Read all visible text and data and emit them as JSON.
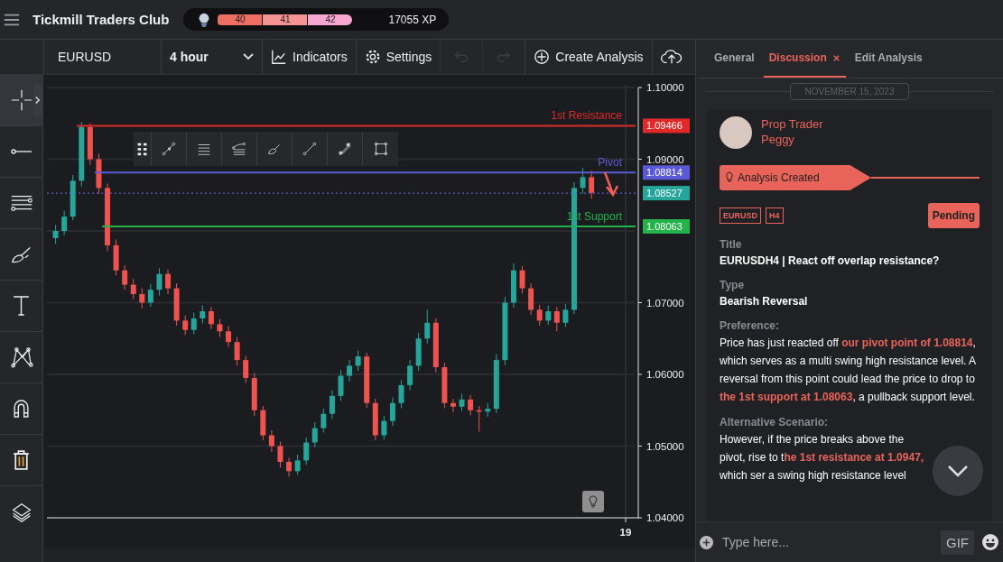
{
  "app": {
    "title": "Tickmill Traders Club",
    "levels": [
      {
        "label": "40",
        "color": "#ee6e62"
      },
      {
        "label": "41",
        "color": "#f59393"
      },
      {
        "label": "42",
        "color": "#f6a6cf"
      }
    ],
    "xp": "17055 XP"
  },
  "toolbar": {
    "symbol": "EURUSD",
    "timeframe": "4 hour",
    "items": [
      {
        "kind": "chart",
        "label": "Indicators",
        "disabled": false
      },
      {
        "kind": "gear",
        "label": "Settings",
        "disabled": false
      },
      {
        "kind": "undo",
        "disabled": true
      },
      {
        "kind": "redo",
        "disabled": true
      },
      {
        "kind": "plus",
        "label": "Create Analysis",
        "disabled": false
      },
      {
        "kind": "upload",
        "disabled": false
      }
    ]
  },
  "tools": [
    {
      "kind": "crosshair",
      "selected": true
    },
    {
      "kind": "hline",
      "selected": false
    },
    {
      "kind": "channel",
      "selected": false
    },
    {
      "kind": "brush",
      "selected": false
    },
    {
      "kind": "text",
      "selected": false
    },
    {
      "kind": "pattern",
      "selected": false
    },
    {
      "kind": "magnet",
      "selected": false
    },
    {
      "kind": "trash",
      "selected": false
    },
    {
      "kind": "layers",
      "selected": false
    }
  ],
  "drawing_tools": [
    {
      "kind": "grip"
    },
    {
      "kind": "ray"
    },
    {
      "kind": "parallel"
    },
    {
      "kind": "fib"
    },
    {
      "kind": "brush"
    },
    {
      "kind": "line"
    },
    {
      "kind": "segment"
    },
    {
      "kind": "rect"
    }
  ],
  "chart": {
    "chart_data": {
      "type": "candlestick",
      "grid": true,
      "ohlc": [
        [
          1.079,
          1.0808,
          1.0782,
          1.08
        ],
        [
          1.08,
          1.0828,
          1.0794,
          1.082
        ],
        [
          1.082,
          1.0878,
          1.0815,
          1.087
        ],
        [
          1.087,
          1.0952,
          1.0862,
          1.0945
        ],
        [
          1.0945,
          1.095,
          1.0892,
          1.09
        ],
        [
          1.09,
          1.0908,
          1.0852,
          1.086
        ],
        [
          1.086,
          1.0866,
          1.0772,
          1.078
        ],
        [
          1.078,
          1.0788,
          1.0738,
          1.0745
        ],
        [
          1.0745,
          1.0752,
          1.0718,
          1.0725
        ],
        [
          1.0725,
          1.0733,
          1.0705,
          1.0712
        ],
        [
          1.0712,
          1.072,
          1.0692,
          1.07
        ],
        [
          1.07,
          1.0726,
          1.0694,
          1.0718
        ],
        [
          1.0718,
          1.0748,
          1.071,
          1.074
        ],
        [
          1.074,
          1.0746,
          1.0712,
          1.072
        ],
        [
          1.072,
          1.0727,
          1.0668,
          1.0675
        ],
        [
          1.0675,
          1.0682,
          1.0655,
          1.0662
        ],
        [
          1.0662,
          1.0686,
          1.0656,
          1.0678
        ],
        [
          1.0678,
          1.0696,
          1.0671,
          1.0688
        ],
        [
          1.0688,
          1.0694,
          1.0663,
          1.067
        ],
        [
          1.067,
          1.0677,
          1.0652,
          1.066
        ],
        [
          1.066,
          1.0667,
          1.0638,
          1.0645
        ],
        [
          1.0645,
          1.0652,
          1.0612,
          1.062
        ],
        [
          1.062,
          1.0626,
          1.0588,
          1.0595
        ],
        [
          1.0595,
          1.0602,
          1.0542,
          1.055
        ],
        [
          1.055,
          1.0556,
          1.0508,
          1.0515
        ],
        [
          1.0515,
          1.0522,
          1.0492,
          1.05
        ],
        [
          1.05,
          1.0506,
          1.047,
          1.0478
        ],
        [
          1.0478,
          1.0484,
          1.0457,
          1.0465
        ],
        [
          1.0465,
          1.0488,
          1.046,
          1.048
        ],
        [
          1.048,
          1.0512,
          1.0474,
          1.0505
        ],
        [
          1.0505,
          1.0533,
          1.0498,
          1.0525
        ],
        [
          1.0525,
          1.0552,
          1.0519,
          1.0545
        ],
        [
          1.0545,
          1.0578,
          1.0538,
          1.057
        ],
        [
          1.057,
          1.0606,
          1.0563,
          1.0598
        ],
        [
          1.0598,
          1.062,
          1.059,
          1.0612
        ],
        [
          1.0612,
          1.0633,
          1.0605,
          1.0625
        ],
        [
          1.0625,
          1.063,
          1.0553,
          1.056
        ],
        [
          1.056,
          1.0566,
          1.0508,
          1.0515
        ],
        [
          1.0515,
          1.0542,
          1.0509,
          1.0535
        ],
        [
          1.0535,
          1.0568,
          1.0528,
          1.056
        ],
        [
          1.056,
          1.0592,
          1.0553,
          1.0585
        ],
        [
          1.0585,
          1.062,
          1.0578,
          1.0612
        ],
        [
          1.0612,
          1.0658,
          1.0605,
          1.065
        ],
        [
          1.065,
          1.069,
          1.0643,
          1.0672
        ],
        [
          1.0672,
          1.0678,
          1.0603,
          1.061
        ],
        [
          1.061,
          1.0616,
          1.0553,
          1.056
        ],
        [
          1.056,
          1.0566,
          1.0547,
          1.0555
        ],
        [
          1.0555,
          1.0573,
          1.0549,
          1.0565
        ],
        [
          1.0565,
          1.0571,
          1.0543,
          1.055
        ],
        [
          1.055,
          1.0556,
          1.052,
          1.0548
        ],
        [
          1.0548,
          1.056,
          1.0541,
          1.0552
        ],
        [
          1.0552,
          1.0628,
          1.0546,
          1.062
        ],
        [
          1.062,
          1.0708,
          1.0613,
          1.07
        ],
        [
          1.07,
          1.0755,
          1.0693,
          1.0745
        ],
        [
          1.0745,
          1.0751,
          1.0713,
          1.072
        ],
        [
          1.072,
          1.0727,
          1.0683,
          1.069
        ],
        [
          1.069,
          1.0697,
          1.0668,
          1.0675
        ],
        [
          1.0675,
          1.0696,
          1.0669,
          1.0688
        ],
        [
          1.0688,
          1.0694,
          1.066,
          1.0672
        ],
        [
          1.0672,
          1.0698,
          1.0666,
          1.069
        ],
        [
          1.069,
          1.0868,
          1.0684,
          1.086
        ],
        [
          1.086,
          1.0888,
          1.0852,
          1.0875
        ],
        [
          1.0875,
          1.0884,
          1.0845,
          1.0853
        ]
      ],
      "ylim": [
        1.04,
        1.1
      ],
      "annotations": [
        "19"
      ],
      "ref_lines": [
        {
          "axis": "y",
          "value": 1.09466,
          "label": "1st Resistance",
          "color": "#e02a2a"
        },
        {
          "axis": "y",
          "value": 1.08814,
          "label": "Pivot",
          "color": "#5a5ad6"
        },
        {
          "axis": "y",
          "value": 1.08527,
          "color": "#6a6ae0"
        },
        {
          "axis": "y",
          "value": 1.08063,
          "label": "1st Support",
          "color": "#23b34a"
        }
      ],
      "yticks": [
        {
          "value": 1.1,
          "label": "1.10000"
        },
        {
          "value": 1.09,
          "label": "1.09000"
        },
        {
          "value": 1.07,
          "label": "1.07000"
        },
        {
          "value": 1.06,
          "label": "1.06000"
        },
        {
          "value": 1.05,
          "label": "1.05000"
        },
        {
          "value": 1.04,
          "label": "1.04000"
        }
      ]
    },
    "price_markers": [
      {
        "text": "1.09466",
        "color": "#e02a2a"
      },
      {
        "text": "1.08814",
        "color": "#5a5ad6"
      },
      {
        "text": "1.08527",
        "color": "#26a69a"
      },
      {
        "text": "1.08063",
        "color": "#23b34a"
      }
    ]
  },
  "panel": {
    "tabs": [
      {
        "label": "General",
        "selected": false,
        "closable": false
      },
      {
        "label": "Discussion",
        "selected": true,
        "closable": true
      },
      {
        "label": "Edit Analysis",
        "selected": false,
        "closable": false
      }
    ],
    "date": "NOVEMBER 15, 2023",
    "post": {
      "role": "Prop Trader",
      "name": "Peggy",
      "event": "Analysis Created",
      "tags": [
        "EURUSD",
        "H4"
      ],
      "status": "Pending",
      "sections": [
        {
          "heading": "Title",
          "text": "EURUSDH4 | React off overlap resistance?",
          "kind": "bold"
        },
        {
          "heading": "Type",
          "text": "Bearish Reversal",
          "kind": "bold"
        },
        {
          "heading": "Preference:",
          "text": "Price has just reacted off **our pivot point of 1.08814**, which serves as a multi swing high resistance level. A reversal from this point could lead the price to drop to **the 1st support at 1.08063**, a pullback support level.",
          "kind": "plain"
        },
        {
          "heading": "Alternative Scenario:",
          "text": "However, if the price breaks above the pivot, rise to t**he 1st resistance at 1.0947,** which ser a swing high resistance level",
          "kind": "narrow"
        }
      ]
    },
    "composer": {
      "placeholder": "Type here...",
      "gif": "GIF"
    }
  }
}
